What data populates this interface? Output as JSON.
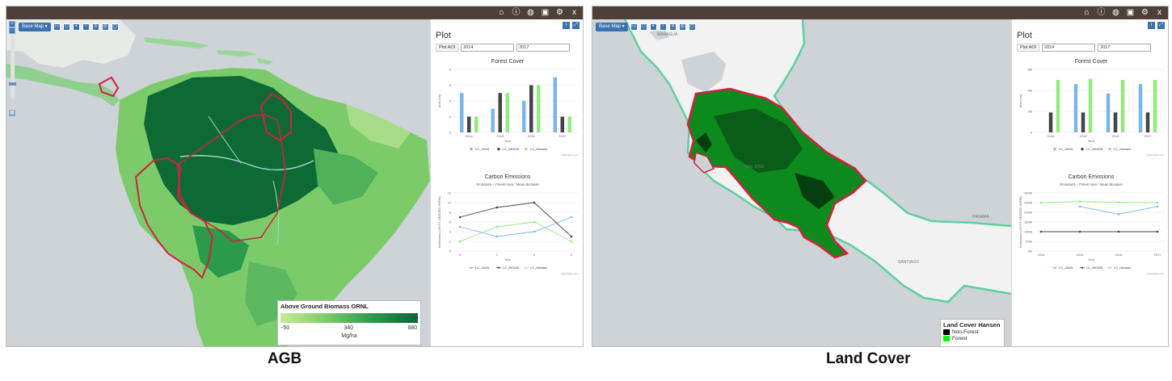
{
  "panels": [
    {
      "id": "agb",
      "caption": "AGB",
      "basemap_label": "Base Map ▾",
      "topbar_icons": [
        "home-icon",
        "info-icon",
        "globe-icon",
        "print-icon",
        "settings-icon",
        "close-icon"
      ],
      "topbar_glyphs": [
        "⌂",
        "ⓘ",
        "◍",
        "▣",
        "⚙",
        "x"
      ],
      "plot": {
        "title": "Plot",
        "aoi_label": "Plot AOI",
        "start_year": "2014",
        "end_year": "2017"
      },
      "legend": {
        "title": "Above Ground Biomass ORNL",
        "min": "-50",
        "mid": "340",
        "max": "680",
        "unit": "Mg/ha"
      }
    },
    {
      "id": "landcover",
      "caption": "Land Cover",
      "basemap_label": "Base Map ▾",
      "topbar_icons": [
        "home-icon",
        "info-icon",
        "globe-icon",
        "print-icon",
        "settings-icon",
        "close-icon"
      ],
      "topbar_glyphs": [
        "⌂",
        "ⓘ",
        "◍",
        "▣",
        "⚙",
        "x"
      ],
      "plot": {
        "title": "Plot",
        "aoi_label": "Plot AOI",
        "start_year": "2014",
        "end_year": "2017"
      },
      "legend": {
        "title": "Land Cover Hansen",
        "items": [
          {
            "label": "Non-Forest",
            "color": "#000000"
          },
          {
            "label": "Forest",
            "color": "#00ff00"
          }
        ]
      },
      "map_labels": [
        "MANAGUA",
        "SAN JOSÉ",
        "PANAMÁ",
        "SANTIAGO"
      ]
    }
  ],
  "colors": {
    "topbar": "#4e4038",
    "accent": "#3b72b0",
    "jaxa": "#7cb5ec",
    "modis": "#434348",
    "hansen": "#90ed7d",
    "aoi_outline": "#d4203c"
  },
  "chart_data": [
    {
      "panel": "agb",
      "type": "bar",
      "title": "Forest Cover",
      "xlabel": "Year",
      "ylabel": "Area (ha)",
      "categories": [
        "2014",
        "2015",
        "2016",
        "2017"
      ],
      "yticks": [
        "0",
        "2",
        "4",
        "6",
        "8"
      ],
      "ylim": [
        0,
        8
      ],
      "series": [
        {
          "name": "LC_JAXA",
          "values": [
            5,
            3,
            4,
            7
          ]
        },
        {
          "name": "LC_MODIS",
          "values": [
            2,
            5,
            6,
            2
          ]
        },
        {
          "name": "LC_Hansen",
          "values": [
            2,
            5,
            6,
            2
          ]
        }
      ],
      "credit": "Highcharts.com"
    },
    {
      "panel": "agb",
      "type": "line",
      "title": "Carbon Emissions",
      "subtitle": "Emissions = Forest Area * Mean Biomass",
      "xlabel": "Year",
      "ylabel": "Emissions (UNITS NEEDED HERE)",
      "categories": [
        "0",
        "1",
        "2",
        "3"
      ],
      "yticks": [
        "0",
        "2",
        "4",
        "6",
        "8",
        "10",
        "12"
      ],
      "ylim": [
        0,
        12
      ],
      "series": [
        {
          "name": "LC_JAXA",
          "values": [
            5,
            3,
            4,
            7
          ]
        },
        {
          "name": "LC_MODIS",
          "values": [
            7,
            9,
            10,
            3
          ]
        },
        {
          "name": "LC_Hansen",
          "values": [
            2,
            5,
            6,
            2
          ]
        }
      ],
      "credit": "Highcharts.com"
    },
    {
      "panel": "landcover",
      "type": "bar",
      "title": "Forest Cover",
      "xlabel": "Year",
      "ylabel": "Area (ha)",
      "categories": [
        "2014",
        "2015",
        "2016",
        "2017"
      ],
      "yticks": [
        "0",
        "2M",
        "4M",
        "6M"
      ],
      "ylim": [
        0,
        6
      ],
      "series": [
        {
          "name": "LC_JAXA",
          "values": [
            0,
            4.6,
            3.7,
            4.6
          ]
        },
        {
          "name": "LC_MODIS",
          "values": [
            1.9,
            1.9,
            1.9,
            1.9
          ]
        },
        {
          "name": "LC_Hansen",
          "values": [
            5.0,
            5.1,
            5.0,
            5.0
          ]
        }
      ],
      "credit": "Highcharts.com"
    },
    {
      "panel": "landcover",
      "type": "line",
      "title": "Carbon Emissions",
      "subtitle": "Emissions = Forest Area * Mean Biomass",
      "xlabel": "Year",
      "ylabel": "Emissions (UNITS NEEDED HERE)",
      "categories": [
        "2014",
        "2015",
        "2016",
        "2017"
      ],
      "yticks": [
        "0M",
        "50M",
        "100M",
        "150M",
        "200M",
        "250M",
        "300M"
      ],
      "ylim": [
        0,
        300
      ],
      "series": [
        {
          "name": "LC_JAXA",
          "values": [
            null,
            230,
            190,
            230
          ]
        },
        {
          "name": "LC_MODIS",
          "values": [
            100,
            100,
            100,
            100
          ]
        },
        {
          "name": "LC_Hansen",
          "values": [
            250,
            256,
            252,
            250
          ]
        }
      ],
      "credit": "Highcharts.com"
    }
  ]
}
